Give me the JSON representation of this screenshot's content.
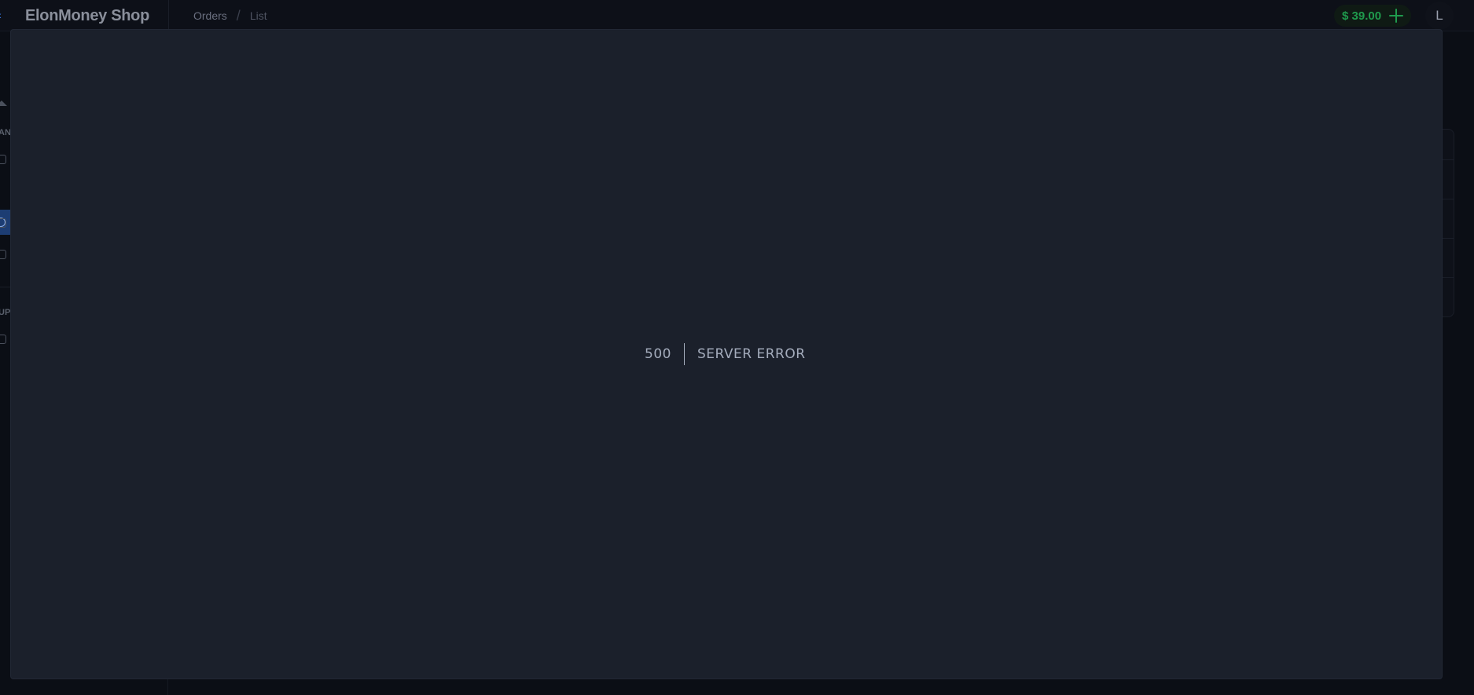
{
  "header": {
    "brand": "ElonMoney Shop",
    "breadcrumb": [
      "Orders",
      "List"
    ],
    "balance": "$ 39.00",
    "avatar_initial": "L"
  },
  "sidebar": {
    "section_labels": [
      "AN",
      "UP"
    ]
  },
  "error": {
    "code": "500",
    "message": "SERVER ERROR"
  },
  "colors": {
    "accent": "#3b82f6",
    "balance_green": "#1f9a4d",
    "modal_bg": "#1b202b",
    "page_bg": "#0b0e15"
  },
  "icons": {
    "menu_toggle": "chevron-collapse-icon",
    "add_funds": "plus-icon"
  }
}
